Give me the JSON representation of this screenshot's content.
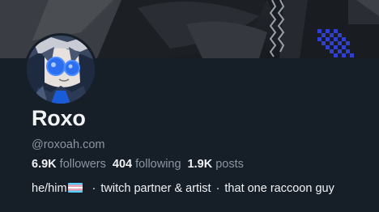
{
  "profile": {
    "display_name": "Roxo",
    "handle": "@roxoah.com",
    "stats": {
      "followers_count": "6.9K",
      "followers_label": "followers",
      "following_count": "404",
      "following_label": "following",
      "posts_count": "1.9K",
      "posts_label": "posts"
    },
    "bio": {
      "pronouns": "he/him",
      "flag_icon": "transgender-flag-icon",
      "separator": "·",
      "part_1": "twitch partner & artist",
      "part_2": "that one raccoon guy"
    }
  },
  "colors": {
    "background": "#161e27",
    "text_primary": "#f1f3f5",
    "text_secondary": "#8c96a3"
  }
}
